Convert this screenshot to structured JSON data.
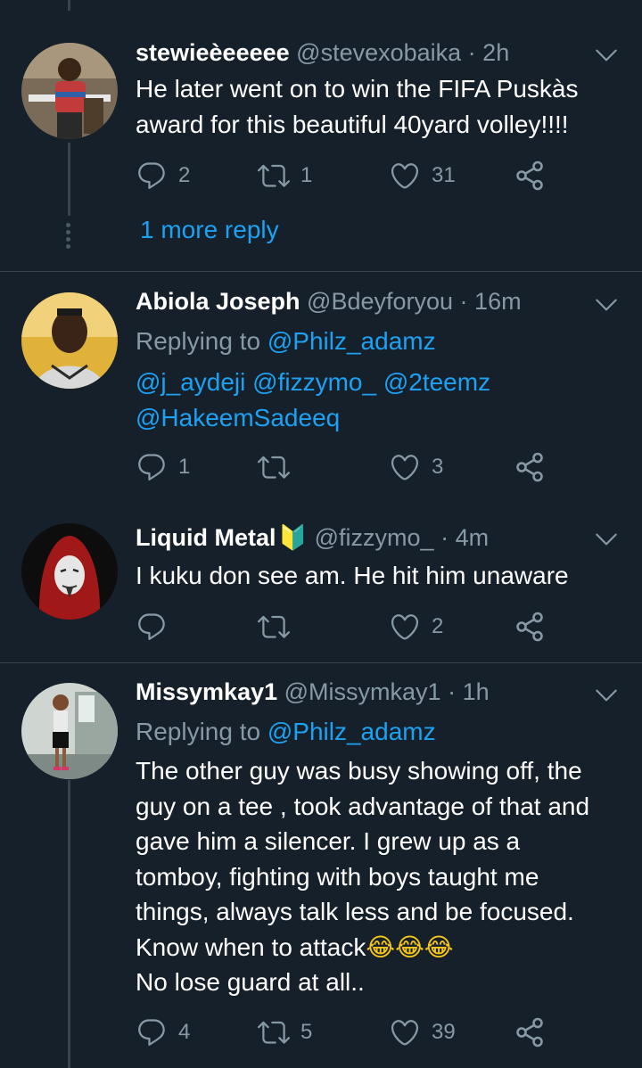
{
  "tweets": [
    {
      "name": "stewieèeeeee",
      "handle": "@stevexobaika",
      "dot": " · ",
      "time": "2h",
      "text": "He later went on to win the FIFA Puskàs award for this beautiful 40yard volley!!!!",
      "replies": "2",
      "retweets": "1",
      "likes": "31",
      "more_replies": "1 more reply"
    },
    {
      "name": "Abiola Joseph",
      "handle": "@Bdeyforyou",
      "dot": " · ",
      "time": "16m",
      "replying_label": "Replying to ",
      "replying_to": "@Philz_adamz",
      "mentions_line1": "@j_aydeji @fizzymo_ @2teemz",
      "mentions_line2": "@HakeemSadeeq",
      "replies": "1",
      "retweets": "",
      "likes": "3"
    },
    {
      "name": "Liquid Metal",
      "badge_emoji": "🔰",
      "handle": "@fizzymo_",
      "dot": " · ",
      "time": "4m",
      "text": "I kuku don see am. He hit him unaware",
      "replies": "",
      "retweets": "",
      "likes": "2"
    },
    {
      "name": "Missymkay1",
      "handle": "@Missymkay1",
      "dot": " · ",
      "time": "1h",
      "replying_label": "Replying to ",
      "replying_to": "@Philz_adamz",
      "text_line1": "The other guy was busy showing off, the",
      "text_line2": "guy on a tee , took advantage of that and",
      "text_line3": "gave him a silencer. I grew up as a",
      "text_line4": "tomboy, fighting with boys taught me",
      "text_line5": "things, always talk less and be focused.",
      "text_line6": "Know when to attack",
      "text_emoji": "😂😂😂",
      "text_line7": "No lose guard at all..",
      "replies": "4",
      "retweets": "5",
      "likes": "39"
    }
  ],
  "icons": {
    "reply": "reply-icon",
    "retweet": "retweet-icon",
    "like": "heart-icon",
    "share": "share-icon",
    "caret": "chevron-down-icon"
  },
  "colors": {
    "background": "#15202b",
    "secondary_text": "#8899a6",
    "link": "#1da1f2",
    "divider": "#38444d"
  }
}
